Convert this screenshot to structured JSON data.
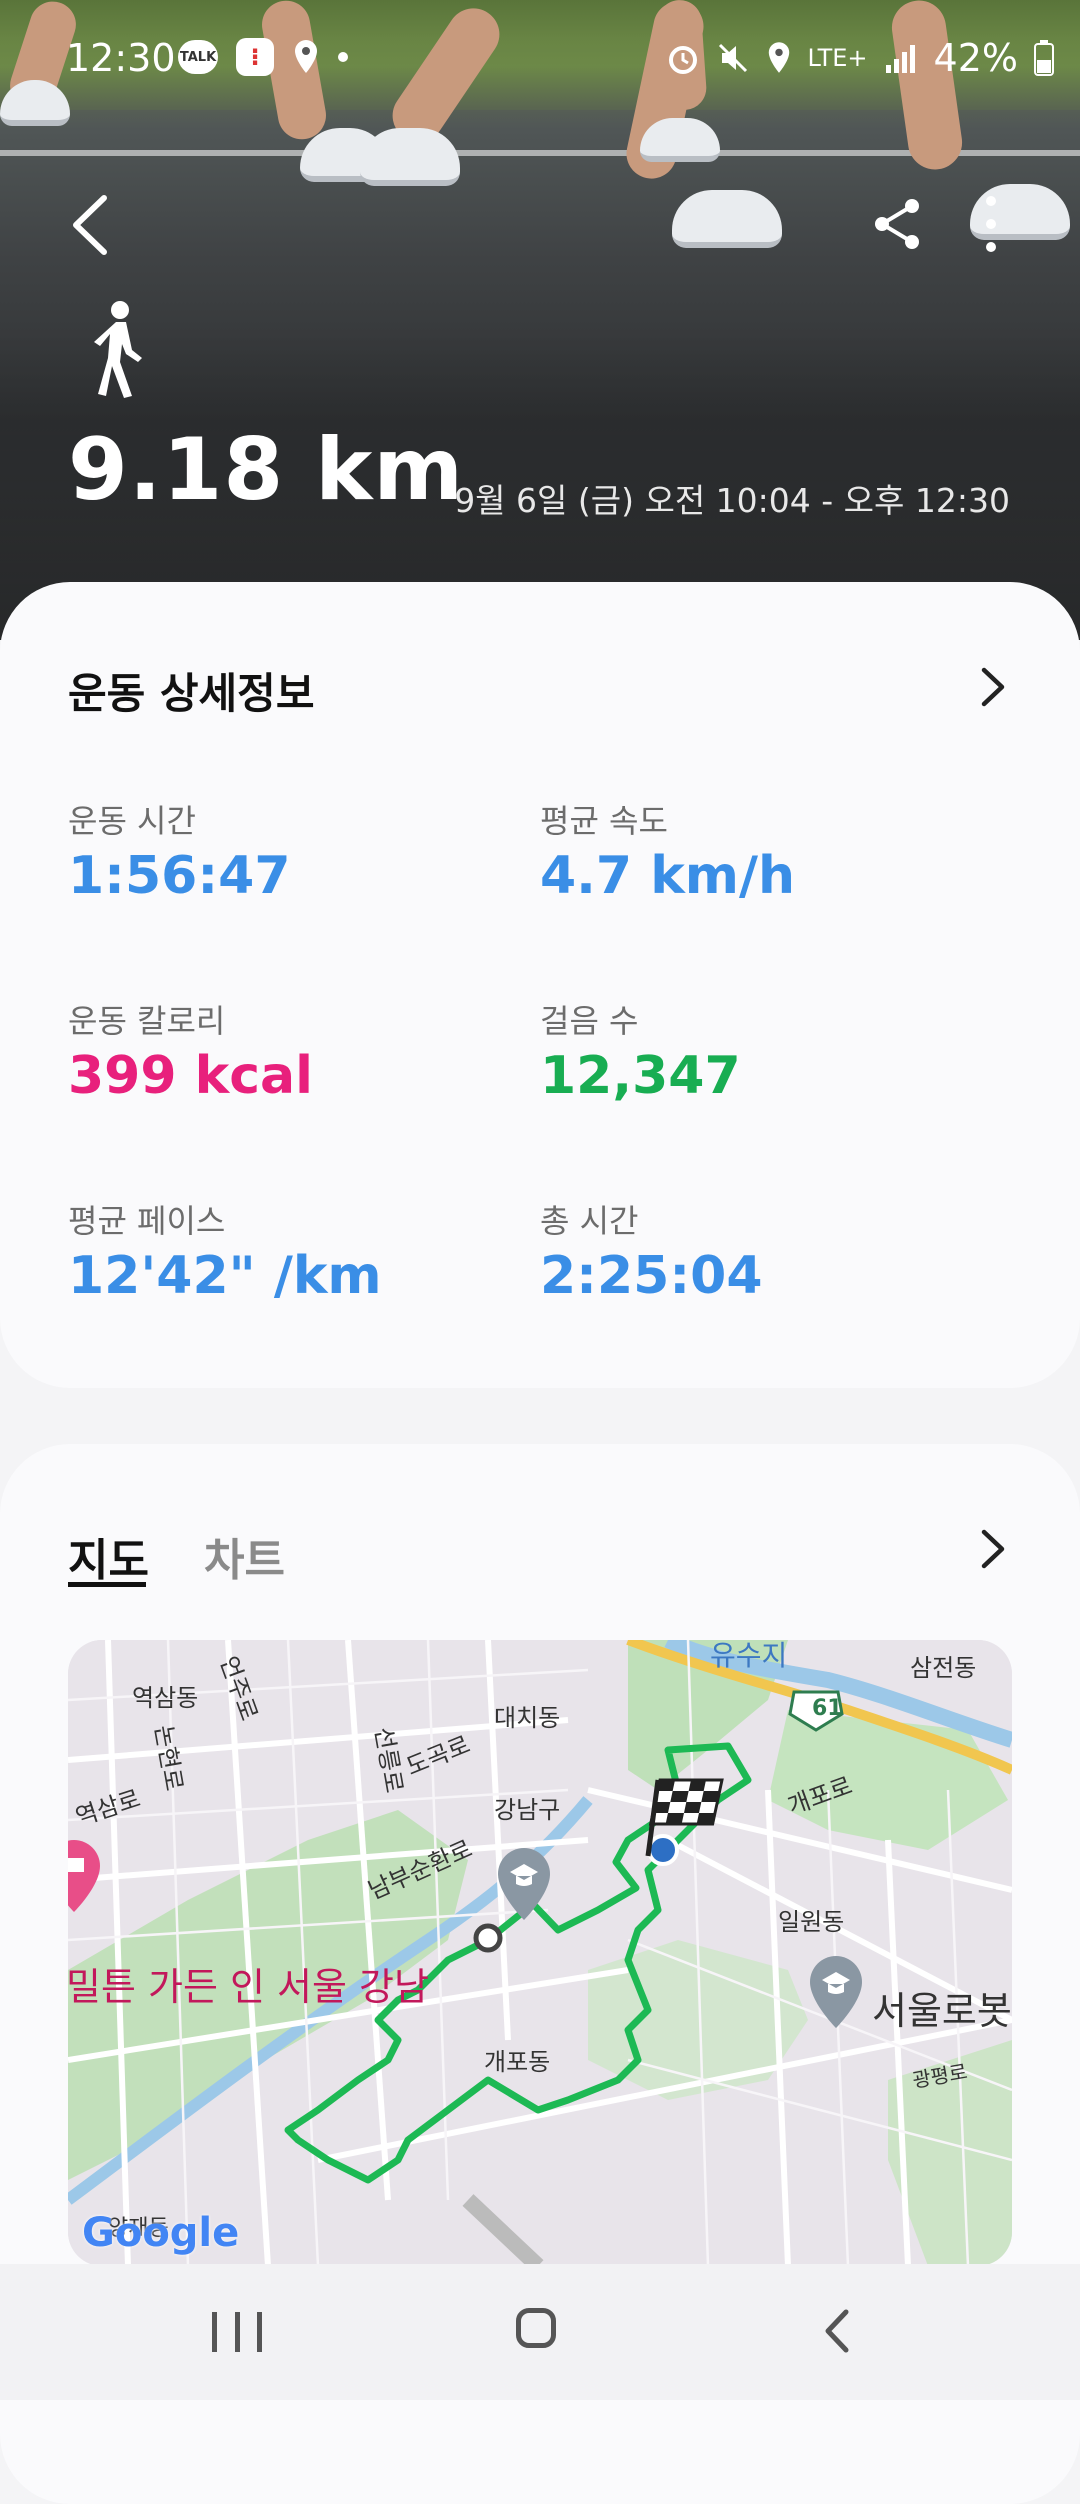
{
  "status_bar": {
    "time": "12:30",
    "talk_label": "TALK",
    "network": "LTE+",
    "battery": "42%"
  },
  "hero": {
    "distance": "9.18 km",
    "date_range": "9월 6일 (금) 오전 10:04 - 오후 12:30",
    "activity_icon": "walking-person-icon"
  },
  "details": {
    "title": "운동 상세정보",
    "stats": [
      {
        "label": "운동 시간",
        "value": "1:56:47",
        "color": "#3a8ee6"
      },
      {
        "label": "평균 속도",
        "value": "4.7 km/h",
        "color": "#3a8ee6"
      },
      {
        "label": "운동 칼로리",
        "value": "399 kcal",
        "color": "#e8207c"
      },
      {
        "label": "걸음 수",
        "value": "12,347",
        "color": "#18ad52"
      },
      {
        "label": "평균 페이스",
        "value": "12'42\" /km",
        "color": "#3a8ee6"
      },
      {
        "label": "총 시간",
        "value": "2:25:04",
        "color": "#3a8ee6"
      }
    ]
  },
  "map_section": {
    "tabs": [
      {
        "label": "지도",
        "active": true
      },
      {
        "label": "차트",
        "active": false
      }
    ],
    "labels": {
      "yuksam": "역삼동",
      "samjeon": "삼전동",
      "daechi": "대치동",
      "gangnam": "강남구",
      "gaepo": "개포동",
      "ilwon": "일원동",
      "gaepo_ro": "개포로",
      "yeoksam_ro": "역삼로",
      "eonju_ro": "언주로",
      "nonhyeon_ro": "논현로",
      "seolleung_ro": "선릉로",
      "dogok_ro": "도곡로",
      "nambu_ro": "남부순환로",
      "gwangpyeong_ro": "광평로",
      "yangjae": "양재동",
      "hotel": "밀튼 가든 인 서울 강남",
      "robot": "서울로봇",
      "route_number": "61",
      "river_label": "유수지",
      "google": "Google"
    },
    "route_color": "#1db954"
  }
}
